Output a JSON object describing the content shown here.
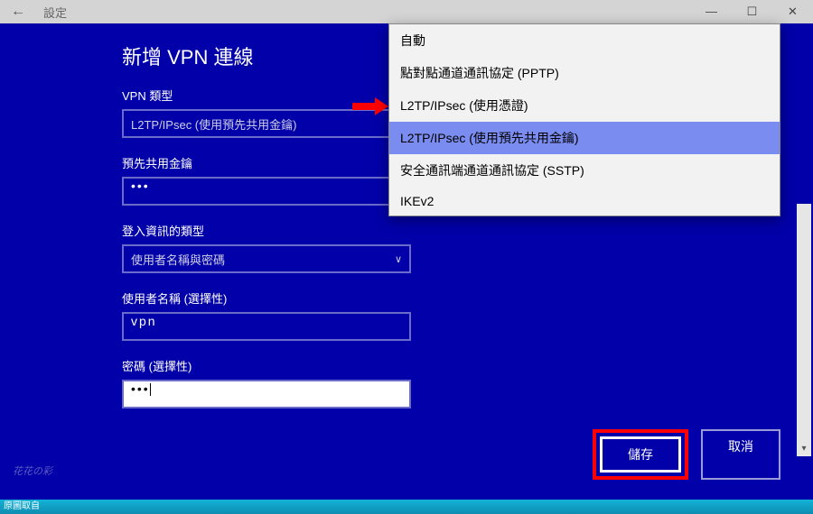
{
  "titlebar": {
    "title": "設定"
  },
  "page": {
    "title": "新增 VPN 連線"
  },
  "fields": {
    "vpn_type": {
      "label": "VPN 類型",
      "value": "L2TP/IPsec (使用預先共用金鑰)"
    },
    "psk": {
      "label": "預先共用金鑰",
      "value": "•••"
    },
    "signin_type": {
      "label": "登入資訊的類型",
      "value": "使用者名稱與密碼"
    },
    "username": {
      "label": "使用者名稱 (選擇性)",
      "value": "vpn"
    },
    "password": {
      "label": "密碼 (選擇性)",
      "value": "•••"
    }
  },
  "dropdown": {
    "options": [
      "自動",
      "點對點通道通訊協定 (PPTP)",
      "L2TP/IPsec (使用憑證)",
      "L2TP/IPsec (使用預先共用金鑰)",
      "安全通訊端通道通訊協定 (SSTP)",
      "IKEv2"
    ],
    "selected_index": 3
  },
  "buttons": {
    "save": "儲存",
    "cancel": "取消"
  },
  "taskbar": {
    "text": "原圖取自"
  }
}
